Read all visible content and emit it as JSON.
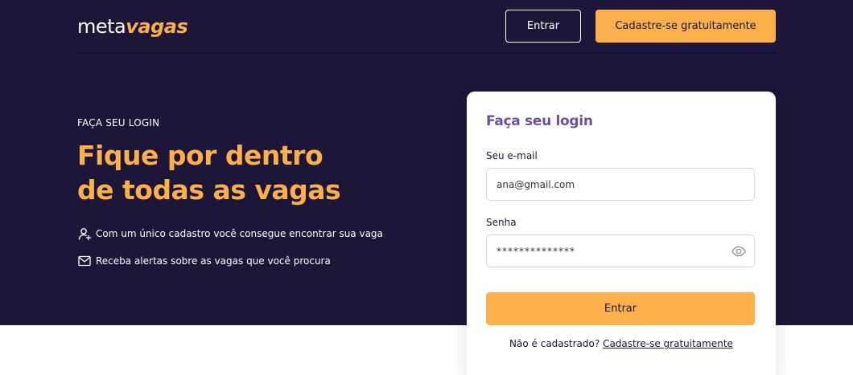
{
  "colors": {
    "hero_bg": "#1d1638",
    "accent": "#fbb04c",
    "card_title": "#6b4f9c"
  },
  "header": {
    "logo_part1": "meta",
    "logo_part2": "vagas",
    "login_label": "Entrar",
    "signup_label": "Cadastre-se gratuitamente"
  },
  "hero": {
    "eyebrow": "FAÇA SEU LOGIN",
    "headline_line1": "Fique por dentro",
    "headline_line2": "de todas as vagas",
    "features": [
      {
        "icon": "user-plus-icon",
        "text": "Com um único cadastro você consegue encontrar sua vaga"
      },
      {
        "icon": "mail-icon",
        "text": "Receba alertas sobre as vagas que você procura"
      }
    ]
  },
  "login_card": {
    "title": "Faça seu login",
    "email_label": "Seu e-mail",
    "email_value": "ana@gmail.com",
    "password_label": "Senha",
    "password_value": "**************",
    "password_toggle_icon": "eye-icon",
    "submit_label": "Entrar",
    "signup_prompt": "Não é cadastrado?",
    "signup_link": "Cadastre-se gratuitamente"
  }
}
